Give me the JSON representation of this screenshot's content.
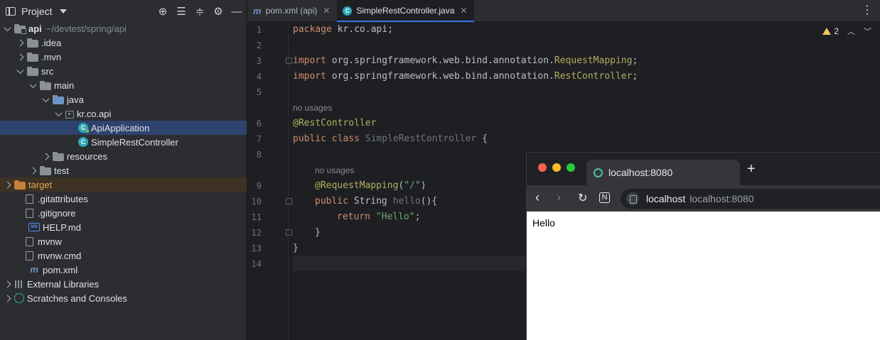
{
  "project_panel": {
    "title": "Project",
    "tree": [
      {
        "label": "api",
        "path": "~/devtest/spring/api"
      },
      {
        "label": ".idea"
      },
      {
        "label": ".mvn"
      },
      {
        "label": "src"
      },
      {
        "label": "main"
      },
      {
        "label": "java"
      },
      {
        "label": "kr.co.api"
      },
      {
        "label": "ApiApplication"
      },
      {
        "label": "SimpleRestController"
      },
      {
        "label": "resources"
      },
      {
        "label": "test"
      },
      {
        "label": "target"
      },
      {
        "label": ".gitattributes"
      },
      {
        "label": ".gitignore"
      },
      {
        "label": "HELP.md"
      },
      {
        "label": "mvnw"
      },
      {
        "label": "mvnw.cmd"
      },
      {
        "label": "pom.xml"
      },
      {
        "label": "External Libraries"
      },
      {
        "label": "Scratches and Consoles"
      }
    ]
  },
  "editor": {
    "tabs": [
      {
        "label": "pom.xml (api)"
      },
      {
        "label": "SimpleRestController.java"
      }
    ],
    "warnings": "2",
    "line_numbers": [
      "1",
      "2",
      "3",
      "4",
      "5",
      "6",
      "7",
      "8",
      "9",
      "10",
      "11",
      "12",
      "13",
      "14"
    ],
    "code": {
      "l1_kw": "package",
      "l1_rest": " kr.co.api;",
      "l3_kw": "import",
      "l3_pkg": " org.springframework.web.bind.annotation.",
      "l3_cls": "RequestMapping",
      "l4_kw": "import",
      "l4_pkg": " org.springframework.web.bind.annotation.",
      "l4_cls": "RestController",
      "hint1": "no usages",
      "l6": "@RestController",
      "l7_kw": "public class",
      "l7_cls": " SimpleRestController",
      "l7_rest": " {",
      "hint2": "no usages",
      "l9_ann": "@RequestMapping",
      "l9_p1": "(",
      "l9_str": "\"/\"",
      "l9_p2": ")",
      "l10_kw": "public",
      "l10_type": " String ",
      "l10_fn": "hello",
      "l10_rest": "(){",
      "l11_kw": "return",
      "l11_str": "\"Hello\"",
      "l11_rest": ";",
      "l12": "}",
      "l13": "}"
    }
  },
  "browser": {
    "tab_title": "localhost:8080",
    "host": "localhost",
    "url": "localhost:8080",
    "content": "Hello"
  }
}
